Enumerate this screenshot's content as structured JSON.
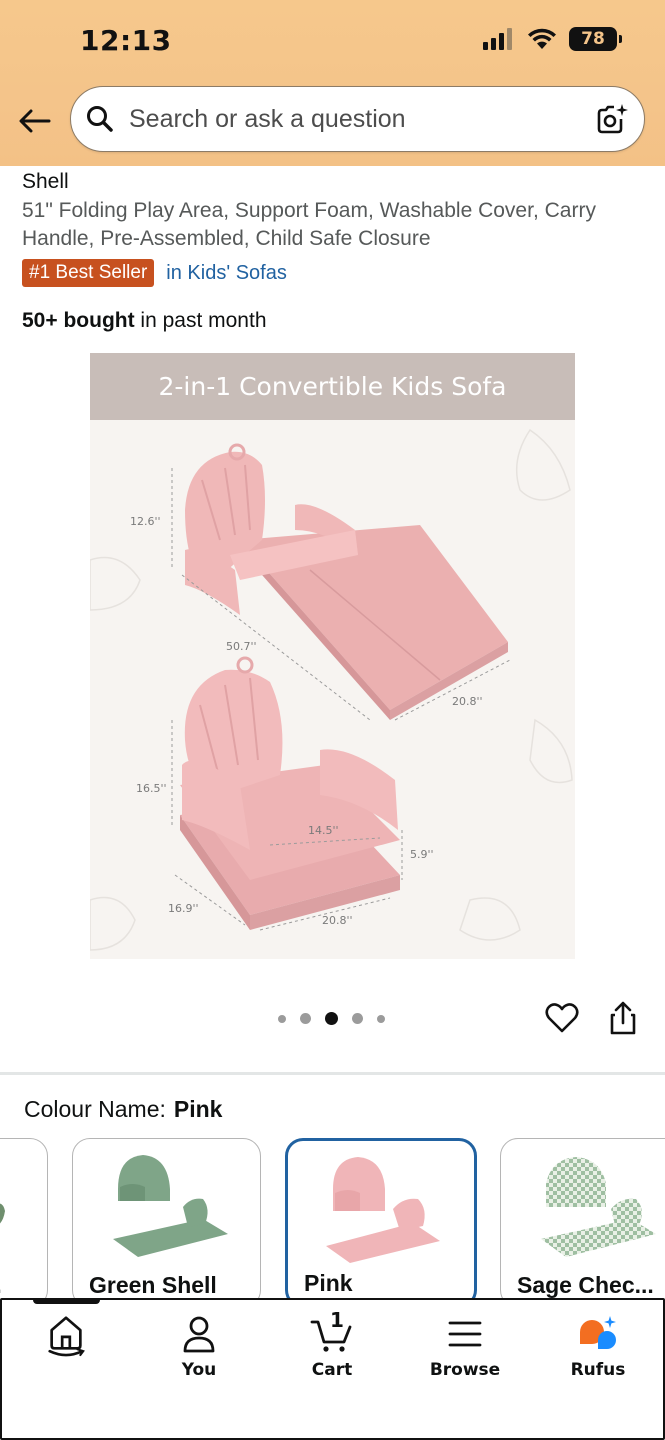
{
  "status_bar": {
    "time": "12:13",
    "battery": "78"
  },
  "header": {
    "search_placeholder": "Search or ask a question"
  },
  "product": {
    "title": "Shell",
    "subtitle": "51\" Folding Play Area, Support Foam, Washable Cover, Carry Handle, Pre-Assembled, Child Safe Closure",
    "badge": "#1 Best Seller",
    "badge_category": "in Kids' Sofas",
    "bought_bold": "50+ bought",
    "bought_rest": " in past month",
    "image": {
      "banner": "2-in-1 Convertible Kids Sofa",
      "dims": {
        "d1": "12.6''",
        "d2": "50.7''",
        "d3": "20.8''",
        "d4": "16.5''",
        "d5": "14.5''",
        "d6": "5.9''",
        "d7": "16.9''",
        "d8": "20.8''"
      }
    },
    "carousel": {
      "total": 5,
      "active_index": 2
    }
  },
  "colour": {
    "label": "Colour Name:",
    "selected": "Pink",
    "options": [
      {
        "label": "..",
        "color": "#6f8f6e"
      },
      {
        "label": "Green Shell",
        "color": "#7fa588"
      },
      {
        "label": "Pink",
        "color": "#f0b5b8"
      },
      {
        "label": "Sage Chec...",
        "color": "#b9cfba"
      }
    ]
  },
  "nav": {
    "items": [
      {
        "label": "",
        "icon": "home-icon"
      },
      {
        "label": "You",
        "icon": "person-icon"
      },
      {
        "label": "Cart",
        "icon": "cart-icon",
        "count": "1"
      },
      {
        "label": "Browse",
        "icon": "menu-icon"
      },
      {
        "label": "Rufus",
        "icon": "rufus-icon"
      }
    ]
  },
  "colors": {
    "header": "#f4c48a",
    "badge": "#c7511f",
    "link": "#2162a1",
    "selected_border": "#2162a1"
  }
}
